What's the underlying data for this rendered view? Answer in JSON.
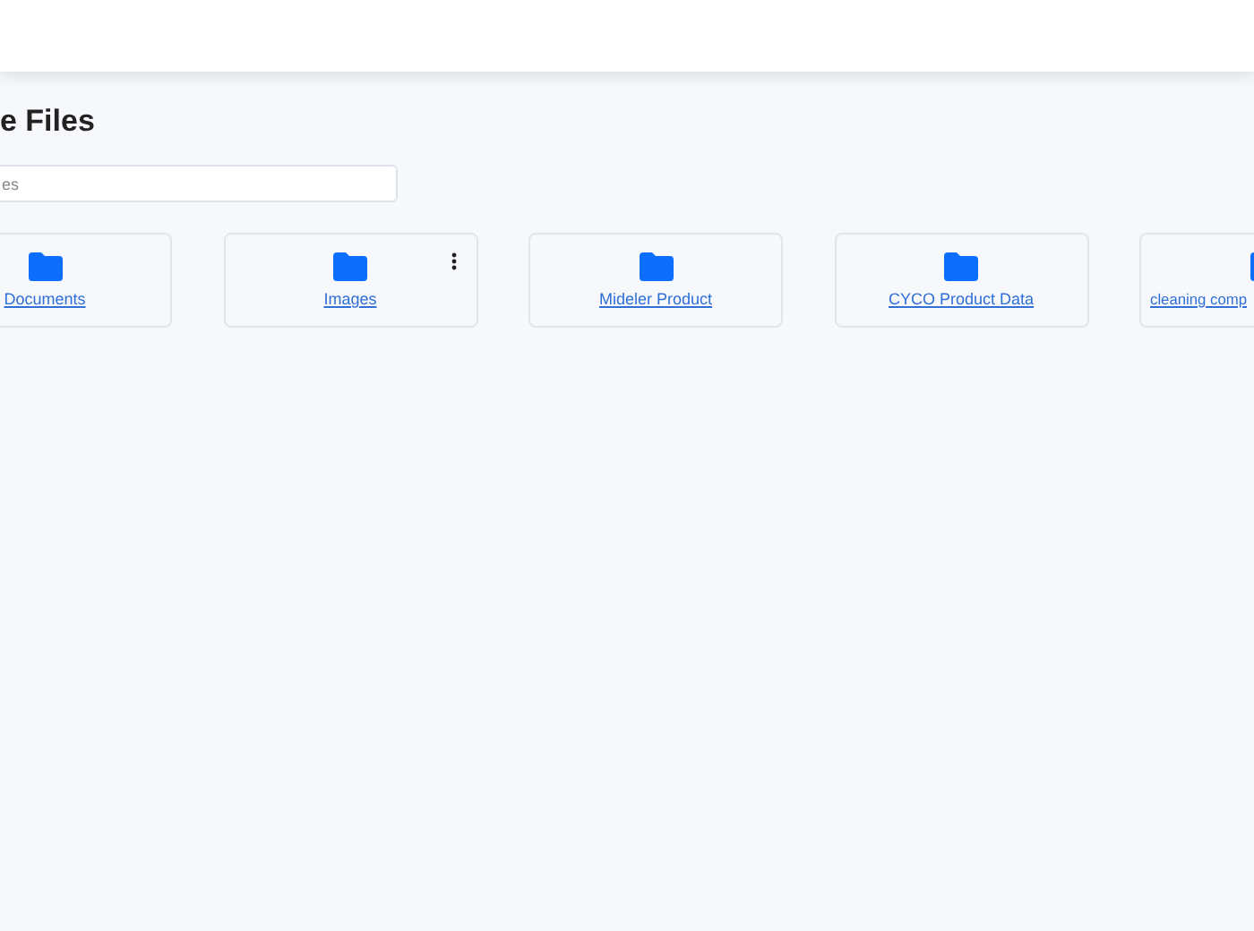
{
  "page": {
    "title": "e Files"
  },
  "search": {
    "placeholder": "es"
  },
  "folders": [
    {
      "name": "Documents",
      "menu": false
    },
    {
      "name": "Images",
      "menu": true
    },
    {
      "name": "Mideler Product",
      "menu": false
    },
    {
      "name": "CYCO Product Data",
      "menu": false
    },
    {
      "name": "cleaning comp",
      "menu": false
    }
  ]
}
